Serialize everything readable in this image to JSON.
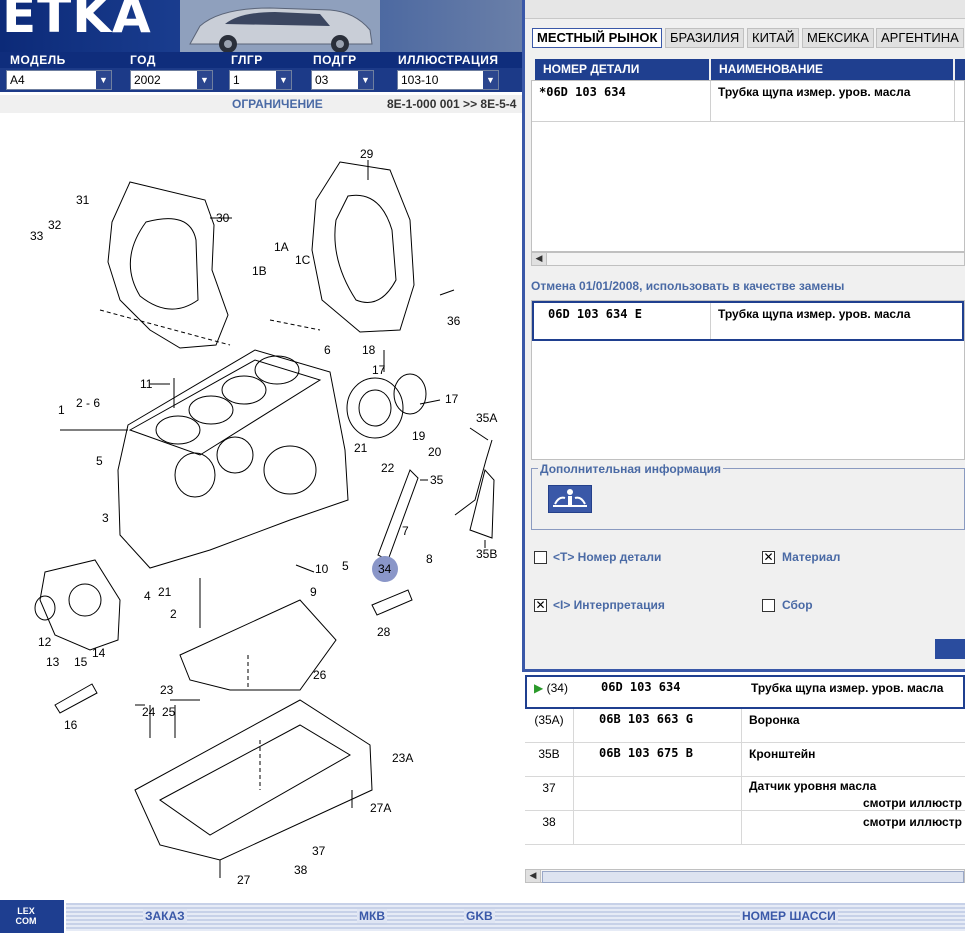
{
  "app": {
    "logo": "ETKA"
  },
  "filters": {
    "labels": [
      "МОДЕЛЬ",
      "ГОД",
      "ГЛГР",
      "ПОДГР",
      "ИЛЛЮСТРАЦИЯ"
    ],
    "values": [
      "A4",
      "2002",
      "1",
      "03",
      "103-10"
    ]
  },
  "restriction": {
    "label": "ОГРАНИЧЕНИЕ",
    "value": "8E-1-000 001 >> 8E-5-4"
  },
  "markets": {
    "tabs": [
      "МЕСТНЫЙ РЫНОК",
      "БРАЗИЛИЯ",
      "КИТАЙ",
      "МЕКСИКА",
      "АРГЕНТИНА"
    ],
    "active": "МЕСТНЫЙ РЫНОК"
  },
  "parts_table": {
    "headers": [
      "НОМЕР ДЕТАЛИ",
      "НАИМЕНОВАНИЕ"
    ],
    "rows": [
      {
        "number": "*06D 103 634",
        "name": "Трубка щупа измер. уров. масла"
      }
    ]
  },
  "replacement": {
    "label": "Отмена 01/01/2008, использовать в качестве замены",
    "rows": [
      {
        "number": "06D 103 634 E",
        "name": "Трубка щупа измер. уров. масла"
      }
    ]
  },
  "additional_info": {
    "label": "Дополнительная информация",
    "icon": "info-icon"
  },
  "options": [
    {
      "label": "<T> Номер детали",
      "checked": false
    },
    {
      "label": "Материал",
      "checked": true
    },
    {
      "label": "<I> Интерпретация",
      "checked": true
    },
    {
      "label": "Сбор",
      "checked": false
    }
  ],
  "parts_list": [
    {
      "pos": "(34)",
      "number": "06D 103 634",
      "name": "Трубка щупа измер. уров. масла",
      "note": "",
      "selected": true
    },
    {
      "pos": "(35A)",
      "number": "06B 103 663 G",
      "name": "Воронка",
      "note": "",
      "selected": false
    },
    {
      "pos": "35B",
      "number": "06B 103 675 B",
      "name": "Кронштейн",
      "note": "",
      "selected": false
    },
    {
      "pos": "37",
      "number": "",
      "name": "Датчик уровня масла",
      "note": "смотри иллюстр",
      "selected": false
    },
    {
      "pos": "38",
      "number": "",
      "name": "",
      "note": "смотри иллюстр",
      "selected": false
    }
  ],
  "diagram": {
    "callouts": [
      "1",
      "2 - 6",
      "2",
      "3",
      "4",
      "5",
      "5",
      "6",
      "7",
      "8",
      "9",
      "10",
      "11",
      "12",
      "13",
      "14",
      "15",
      "16",
      "17",
      "18",
      "17",
      "19",
      "20",
      "21",
      "21",
      "22",
      "23",
      "23A",
      "24",
      "25",
      "26",
      "27",
      "27A",
      "28",
      "29",
      "30",
      "31",
      "32",
      "33",
      "34",
      "35",
      "35A",
      "35B",
      "36",
      "37",
      "38",
      "1A",
      "1B",
      "1C"
    ],
    "highlighted": "34"
  },
  "footer": {
    "logo": "LEX COM",
    "links": [
      "ЗАКАЗ",
      "МКВ",
      "GKB",
      "НОМЕР ШАССИ"
    ]
  },
  "colors": {
    "accent": "#1f3f8f",
    "link": "#4a6aa5",
    "highlight": "#8a96c8"
  }
}
